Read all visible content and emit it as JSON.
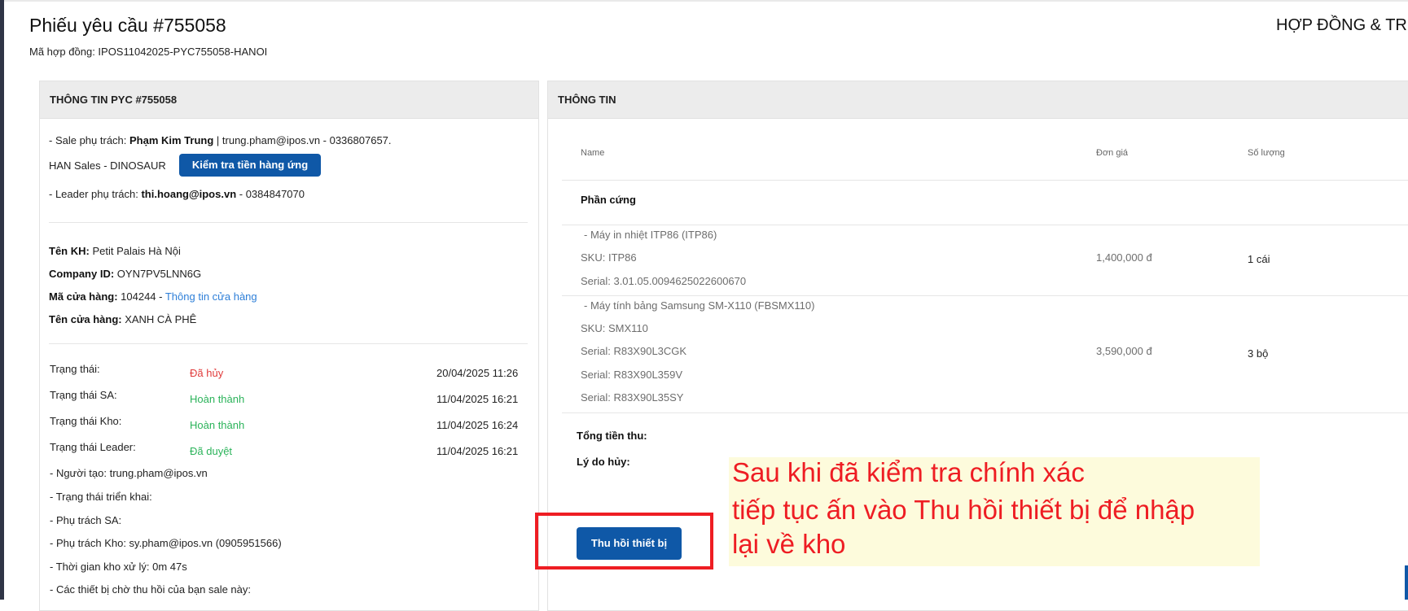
{
  "header": {
    "title": "Phiếu yêu cầu #755058",
    "contract_code": "Mã hợp đồng: IPOS11042025-PYC755058-HANOI",
    "right_title": "HỢP ĐỒNG & TR"
  },
  "left_panel": {
    "title": "THÔNG TIN PYC #755058",
    "sale": {
      "prefix": "- Sale phụ trách: ",
      "name": "Phạm Kim Trung",
      "suffix": " | trung.pham@ipos.vn - 0336807657."
    },
    "team": "HAN Sales - DINOSAUR",
    "check_button": "Kiểm tra tiền hàng ứng",
    "leader": {
      "prefix": "- Leader phụ trách: ",
      "email": "thi.hoang@ipos.vn",
      "suffix": " - 0384847070"
    },
    "customer": {
      "name_label": "Tên KH:",
      "name_value": " Petit Palais Hà Nội",
      "company_label": "Company ID:",
      "company_value": " OYN7PV5LNN6G",
      "store_code_label": "Mã cửa hàng:",
      "store_code_value": " 104244 - ",
      "store_info_link": "Thông tin cửa hàng",
      "store_name_label": "Tên cửa hàng:",
      "store_name_value": " XANH CÀ PHÊ"
    },
    "statuses": [
      {
        "label": "Trạng thái:",
        "value": "Đã hủy",
        "color": "#e03b3b",
        "time": "20/04/2025 11:26"
      },
      {
        "label": "Trạng thái SA:",
        "value": "Hoàn thành",
        "color": "#2bb35a",
        "time": "11/04/2025 16:21"
      },
      {
        "label": "Trạng thái Kho:",
        "value": "Hoàn thành",
        "color": "#2bb35a",
        "time": "11/04/2025 16:24"
      },
      {
        "label": "Trạng thái Leader:",
        "value": "Đã duyệt",
        "color": "#2bb35a",
        "time": "11/04/2025 16:21"
      }
    ],
    "details": [
      "- Người tạo: trung.pham@ipos.vn",
      "- Trạng thái triển khai:",
      "- Phụ trách SA:",
      "- Phụ trách Kho: sy.pham@ipos.vn (0905951566)",
      "- Thời gian kho xử lý: 0m 47s",
      "- Các thiết bị chờ thu hồi của bạn sale này:"
    ]
  },
  "right_panel": {
    "title": "THÔNG TIN",
    "columns": {
      "name": "Name",
      "price": "Đơn giá",
      "qty": "Số lượng"
    },
    "section": "Phần cứng",
    "items": [
      {
        "name": "- Máy in nhiệt ITP86 (ITP86)",
        "sku": "SKU: ITP86",
        "serials": [
          "Serial: 3.01.05.0094625022600670"
        ],
        "price": "1,400,000 đ",
        "qty": "1 cái"
      },
      {
        "name": "- Máy tính bảng Samsung SM-X110 (FBSMX110)",
        "sku": "SKU: SMX110",
        "serials": [
          "Serial: R83X90L3CGK",
          "Serial: R83X90L359V",
          "Serial: R83X90L35SY"
        ],
        "price": "3,590,000 đ",
        "qty": "3 bộ"
      }
    ],
    "total_label": "Tổng tiền thu:",
    "cancel_reason_label": "Lý do hủy:",
    "recall_button": "Thu hồi thiết bị"
  },
  "annotation": {
    "lines": [
      "Sau khi đã kiểm tra chính xác",
      "tiếp tục ấn vào Thu hồi thiết bị để nhập",
      "lại về kho"
    ],
    "color": "#ee1d23",
    "background": "#fdfbdc"
  },
  "colors": {
    "primary_button": "#0f58a7",
    "link": "#2e7fd8",
    "cancelled": "#e03b3b",
    "done": "#2bb35a"
  }
}
